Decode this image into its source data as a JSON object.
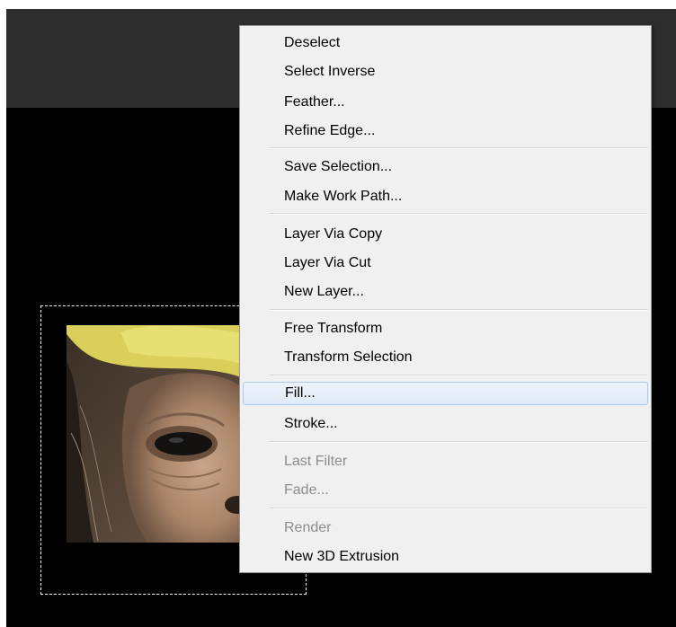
{
  "context_menu": {
    "groups": [
      {
        "items": [
          {
            "label": "Deselect",
            "enabled": true
          },
          {
            "label": "Select Inverse",
            "enabled": true
          },
          {
            "label": "Feather...",
            "enabled": true
          },
          {
            "label": "Refine Edge...",
            "enabled": true
          }
        ]
      },
      {
        "items": [
          {
            "label": "Save Selection...",
            "enabled": true
          },
          {
            "label": "Make Work Path...",
            "enabled": true
          }
        ]
      },
      {
        "items": [
          {
            "label": "Layer Via Copy",
            "enabled": true
          },
          {
            "label": "Layer Via Cut",
            "enabled": true
          },
          {
            "label": "New Layer...",
            "enabled": true
          }
        ]
      },
      {
        "items": [
          {
            "label": "Free Transform",
            "enabled": true
          },
          {
            "label": "Transform Selection",
            "enabled": true
          }
        ]
      },
      {
        "items": [
          {
            "label": "Fill...",
            "enabled": true,
            "highlighted": true
          },
          {
            "label": "Stroke...",
            "enabled": true
          }
        ]
      },
      {
        "items": [
          {
            "label": "Last Filter",
            "enabled": false
          },
          {
            "label": "Fade...",
            "enabled": false
          }
        ]
      },
      {
        "items": [
          {
            "label": "Render",
            "enabled": false
          },
          {
            "label": "New 3D Extrusion",
            "enabled": true
          }
        ]
      }
    ]
  },
  "colors": {
    "toolbar_bg": "#2d2d2d",
    "canvas_bg": "#000000",
    "menu_bg": "#f0f0f0",
    "highlight_border": "#a8c8ec",
    "disabled_text": "#8c8c8c"
  }
}
